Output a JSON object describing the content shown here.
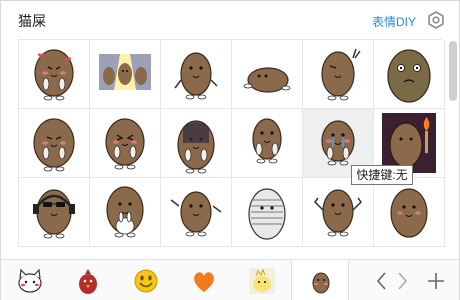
{
  "header": {
    "title": "猫屎",
    "diy_label": "表情DIY"
  },
  "grid": {
    "stickers": [
      {
        "name": "sticker-heart-eyes-laughing"
      },
      {
        "name": "sticker-spotlight-trio"
      },
      {
        "name": "sticker-walking"
      },
      {
        "name": "sticker-lying-down"
      },
      {
        "name": "sticker-wink-peace"
      },
      {
        "name": "sticker-angry-big-eyes"
      },
      {
        "name": "sticker-grinning"
      },
      {
        "name": "sticker-cheering"
      },
      {
        "name": "sticker-gloomy"
      },
      {
        "name": "sticker-stand-still"
      },
      {
        "name": "sticker-sobbing"
      },
      {
        "name": "sticker-holding-torch"
      },
      {
        "name": "sticker-sunglasses-headphones"
      },
      {
        "name": "sticker-hugging-bunny"
      },
      {
        "name": "sticker-dancing"
      },
      {
        "name": "sticker-striped-face"
      },
      {
        "name": "sticker-flexing"
      },
      {
        "name": "sticker-blushing"
      }
    ],
    "hover_index": 10
  },
  "tooltip": {
    "text": "快捷键:无"
  },
  "tabbar": {
    "tabs": [
      {
        "name": "tab-cat-face",
        "icon": "cat-face-icon"
      },
      {
        "name": "tab-red-bird",
        "icon": "red-bird-icon"
      },
      {
        "name": "tab-smiley",
        "icon": "smiley-icon"
      },
      {
        "name": "tab-heart",
        "icon": "heart-icon"
      },
      {
        "name": "tab-chick",
        "icon": "chick-icon"
      },
      {
        "name": "tab-catpoo",
        "icon": "catpoo-icon"
      }
    ],
    "active_index": 5
  },
  "colors": {
    "accent": "#2a8bd6",
    "potato": "#8a6a4a",
    "heart": "#f47a1f",
    "smiley": "#f5c518"
  }
}
